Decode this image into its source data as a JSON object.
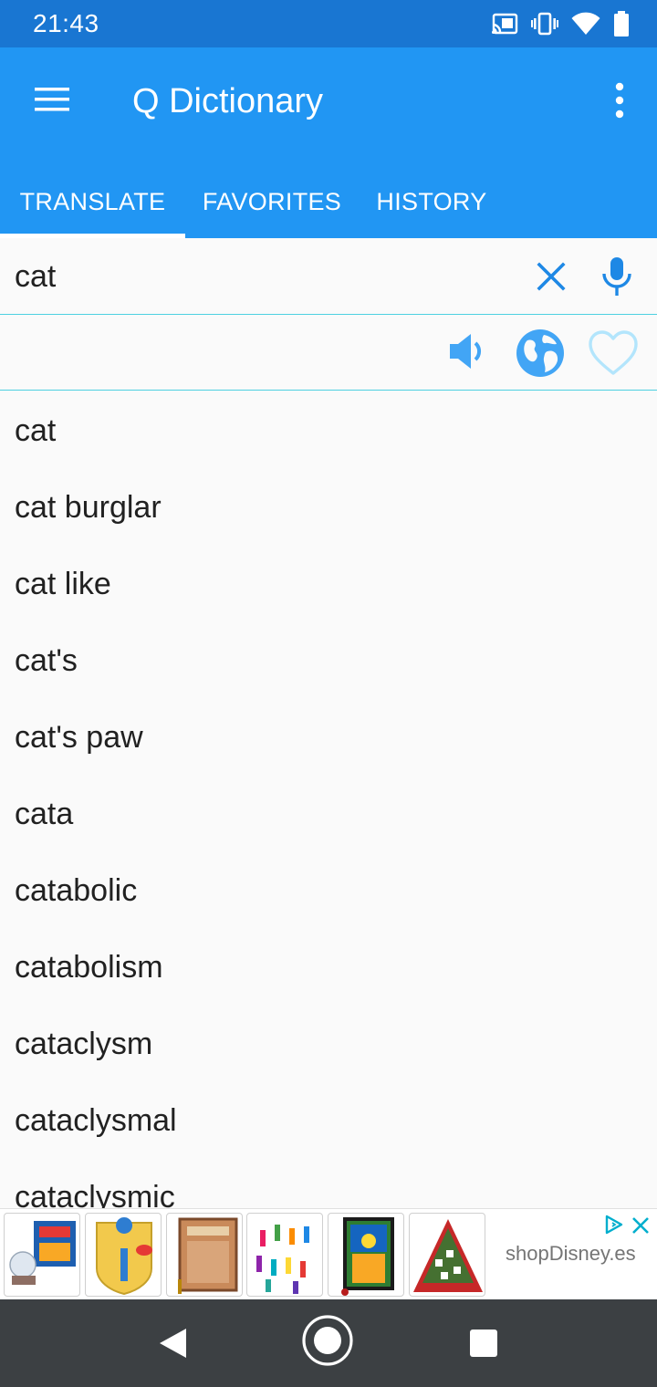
{
  "status_bar": {
    "time": "21:43",
    "icons": [
      "cast-icon",
      "vibrate-icon",
      "wifi-icon",
      "battery-icon"
    ]
  },
  "app_bar": {
    "title": "Q Dictionary",
    "menu_icon": "hamburger-menu-icon",
    "overflow_icon": "more-vert-icon",
    "color": "#2196f3"
  },
  "tabs": [
    {
      "label": "TRANSLATE",
      "active": true
    },
    {
      "label": "FAVORITES",
      "active": false
    },
    {
      "label": "HISTORY",
      "active": false
    }
  ],
  "search": {
    "value": "cat",
    "clear_icon": "close-icon",
    "mic_icon": "mic-icon"
  },
  "actions": {
    "icons": [
      "speaker-icon",
      "globe-icon",
      "heart-outline-icon"
    ],
    "accent_color": "#42a5f5"
  },
  "suggestions": [
    "cat",
    "cat burglar",
    "cat like",
    "cat's",
    "cat's paw",
    "cata",
    "catabolic",
    "catabolism",
    "cataclysm",
    "cataclysmal",
    "cataclysmic"
  ],
  "ad": {
    "brand": "shopDisney.es",
    "choices_icon": "ad-choices-icon",
    "close_icon": "close-icon"
  },
  "nav_bar": {
    "icons": [
      "back-icon",
      "home-icon",
      "recents-icon"
    ]
  }
}
